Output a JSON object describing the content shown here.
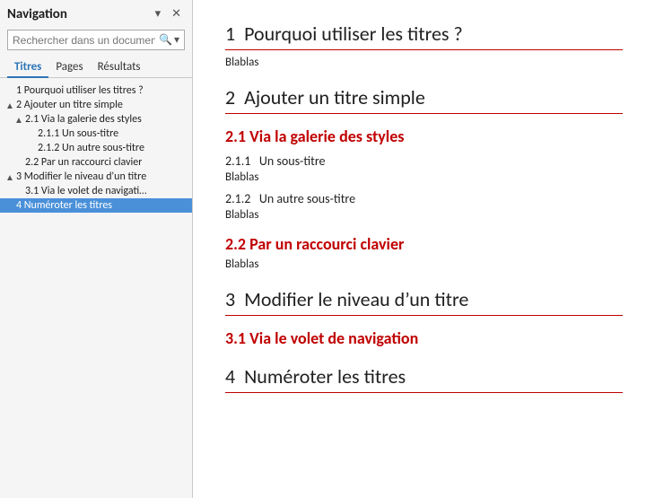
{
  "nav": {
    "title": "Navigation",
    "header_icons": {
      "dropdown": "▾",
      "close": "✕"
    },
    "search": {
      "placeholder": "Rechercher dans un documen",
      "icon": "🔍",
      "dropdown": "▾"
    },
    "tabs": [
      {
        "id": "titres",
        "label": "Titres",
        "active": true
      },
      {
        "id": "pages",
        "label": "Pages",
        "active": false
      },
      {
        "id": "resultats",
        "label": "Résultats",
        "active": false
      }
    ],
    "tree": [
      {
        "id": "h1-1",
        "level": 1,
        "indent": 4,
        "toggle": "",
        "label": "1 Pourquoi utiliser les titres ?",
        "selected": false
      },
      {
        "id": "h1-2",
        "level": 1,
        "indent": 4,
        "toggle": "▲",
        "label": "2 Ajouter un titre simple",
        "selected": false
      },
      {
        "id": "h2-21",
        "level": 2,
        "indent": 14,
        "toggle": "▲",
        "label": "2.1 Via la galerie des styles",
        "selected": false
      },
      {
        "id": "h3-211",
        "level": 3,
        "indent": 28,
        "toggle": "",
        "label": "2.1.1 Un sous-titre",
        "selected": false
      },
      {
        "id": "h3-212",
        "level": 3,
        "indent": 28,
        "toggle": "",
        "label": "2.1.2 Un autre sous-titre",
        "selected": false
      },
      {
        "id": "h2-22",
        "level": 2,
        "indent": 14,
        "toggle": "",
        "label": "2.2 Par un raccourci clavier",
        "selected": false
      },
      {
        "id": "h1-3",
        "level": 1,
        "indent": 4,
        "toggle": "▲",
        "label": "3 Modifier le niveau d'un titre",
        "selected": false
      },
      {
        "id": "h2-31",
        "level": 2,
        "indent": 14,
        "toggle": "",
        "label": "3.1 Via le volet de navigati…",
        "selected": false
      },
      {
        "id": "h1-4",
        "level": 1,
        "indent": 4,
        "toggle": "",
        "label": "4 Numéroter les titres",
        "selected": true
      }
    ]
  },
  "doc": {
    "sections": [
      {
        "type": "h1",
        "text": "1  Pourquoi utiliser les titres ?",
        "body": "Blablas"
      },
      {
        "type": "h1",
        "text": "2  Ajouter un titre simple",
        "body": null
      },
      {
        "type": "h2",
        "text": "2.1 Via la galerie des styles",
        "subsections": [
          {
            "type": "h3",
            "number": "2.1.1",
            "title": "Un sous-titre",
            "body": "Blablas"
          },
          {
            "type": "h3",
            "number": "2.1.2",
            "title": "Un autre sous-titre",
            "body": "Blablas"
          }
        ]
      },
      {
        "type": "h2",
        "text": "2.2 Par un raccourci clavier",
        "body": "Blablas"
      },
      {
        "type": "h1",
        "text": "3  Modifier le niveau d’un titre",
        "body": null
      },
      {
        "type": "h2",
        "text": "3.1 Via le volet de navigation",
        "body": null
      },
      {
        "type": "h1",
        "text": "4  Numéroter les titres",
        "body": null
      }
    ]
  }
}
